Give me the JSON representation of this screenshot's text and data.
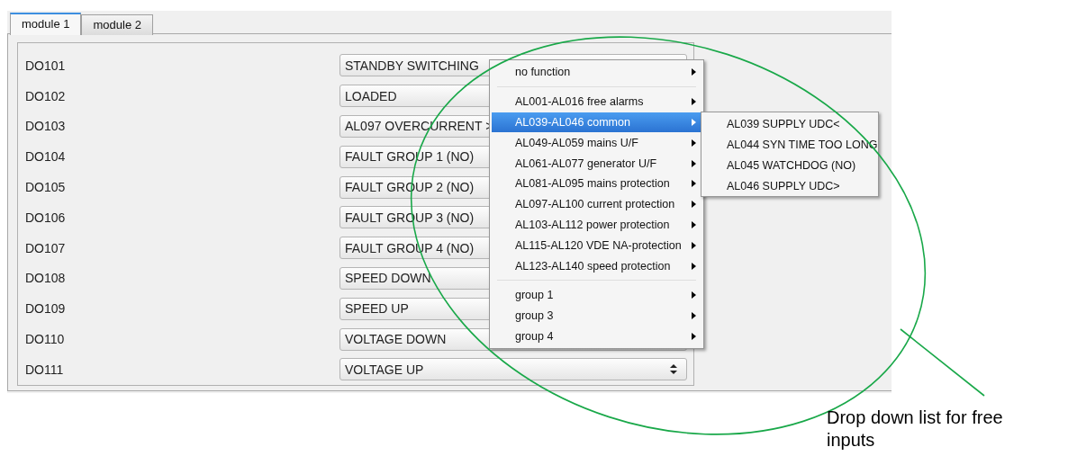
{
  "tabs": [
    {
      "label": "module 1",
      "selected": true
    },
    {
      "label": "module 2",
      "selected": false
    }
  ],
  "rows": [
    {
      "label": "DO101",
      "value": "STANDBY SWITCHING"
    },
    {
      "label": "DO102",
      "value": "LOADED"
    },
    {
      "label": "DO103",
      "value": "AL097 OVERCURRENT >"
    },
    {
      "label": "DO104",
      "value": "FAULT GROUP 1 (NO)"
    },
    {
      "label": "DO105",
      "value": "FAULT GROUP 2 (NO)"
    },
    {
      "label": "DO106",
      "value": "FAULT GROUP 3 (NO)"
    },
    {
      "label": "DO107",
      "value": "FAULT GROUP 4 (NO)"
    },
    {
      "label": "DO108",
      "value": "SPEED DOWN"
    },
    {
      "label": "DO109",
      "value": "SPEED UP"
    },
    {
      "label": "DO110",
      "value": "VOLTAGE DOWN"
    },
    {
      "label": "DO111",
      "value": "VOLTAGE UP"
    }
  ],
  "menu": {
    "sections": [
      [
        {
          "label": "no function",
          "selected": false
        }
      ],
      [
        {
          "label": "AL001-AL016 free alarms",
          "selected": false
        },
        {
          "label": "AL039-AL046 common",
          "selected": true
        },
        {
          "label": "AL049-AL059 mains U/F",
          "selected": false
        },
        {
          "label": "AL061-AL077 generator U/F",
          "selected": false
        },
        {
          "label": "AL081-AL095 mains protection",
          "selected": false
        },
        {
          "label": "AL097-AL100 current protection",
          "selected": false
        },
        {
          "label": "AL103-AL112 power protection",
          "selected": false
        },
        {
          "label": "AL115-AL120 VDE NA-protection",
          "selected": false
        },
        {
          "label": "AL123-AL140 speed protection",
          "selected": false
        }
      ],
      [
        {
          "label": "group 1",
          "selected": false
        },
        {
          "label": "group 3",
          "selected": false
        },
        {
          "label": "group 4",
          "selected": false
        }
      ]
    ]
  },
  "submenu": {
    "items": [
      "AL039 SUPPLY UDC<",
      "AL044 SYN TIME TOO LONG",
      "AL045 WATCHDOG (NO)",
      "AL046 SUPPLY UDC>"
    ]
  },
  "annotation": {
    "caption": "Drop down list for free inputs"
  }
}
